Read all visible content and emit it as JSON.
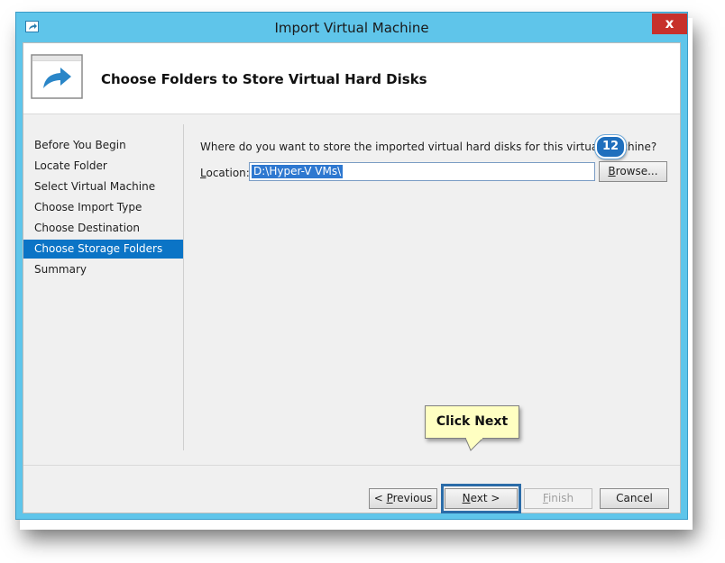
{
  "window": {
    "title": "Import Virtual Machine",
    "close_glyph": "x",
    "title_icon": "import-arrow-icon"
  },
  "header": {
    "title": "Choose Folders to Store Virtual Hard Disks",
    "icon": "import-arrow-icon"
  },
  "nav": {
    "items": [
      {
        "label": "Before You Begin",
        "active": false
      },
      {
        "label": "Locate Folder",
        "active": false
      },
      {
        "label": "Select Virtual Machine",
        "active": false
      },
      {
        "label": "Choose Import Type",
        "active": false
      },
      {
        "label": "Choose Destination",
        "active": false
      },
      {
        "label": "Choose Storage Folders",
        "active": true
      },
      {
        "label": "Summary",
        "active": false
      }
    ]
  },
  "content": {
    "question": "Where do you want to store the imported virtual hard disks for this virtual machine?",
    "step_badge": "12",
    "location_label_first": "L",
    "location_label_rest": "ocation:",
    "location_value": "D:\\Hyper-V VMs\\",
    "browse_first": "B",
    "browse_rest": "rowse..."
  },
  "footer": {
    "previous_prefix": "< ",
    "previous_first": "P",
    "previous_rest": "revious",
    "next_first": "N",
    "next_rest": "ext >",
    "finish_first": "F",
    "finish_rest": "inish",
    "cancel_label": "Cancel"
  },
  "callout": {
    "text": "Click Next"
  },
  "colors": {
    "window_frame": "#5fc5ea",
    "close_button": "#c7312b",
    "selection": "#0b74c6",
    "callout_bg": "#ffffc2",
    "badge": "#1f6fbd"
  }
}
